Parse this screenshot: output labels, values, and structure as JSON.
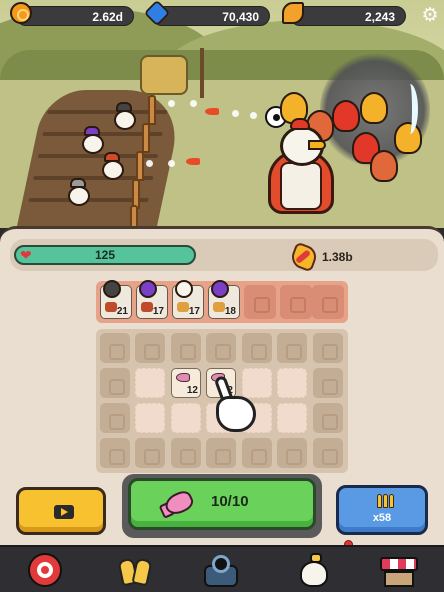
{
  "currency": {
    "coins": "2.62d",
    "gems": "70,430",
    "leaves": "2,243"
  },
  "player": {
    "hp": "125",
    "damage": "1.38b"
  },
  "squad": [
    {
      "level": "21"
    },
    {
      "level": "17"
    },
    {
      "level": "17"
    },
    {
      "level": "18"
    }
  ],
  "merge_grid": [
    {
      "level": "12"
    },
    {
      "level": "12"
    }
  ],
  "actions": {
    "summon": "10/10",
    "ammo": "x58"
  },
  "icons": {
    "top": [
      "coin-icon",
      "gem-icon",
      "leaf-icon",
      "settings-icon"
    ],
    "nav": [
      "target-icon",
      "gloves-icon",
      "cannon-icon",
      "chicken-icon",
      "shop-icon"
    ]
  },
  "colors": {
    "hp_bar": "#56c49a",
    "summon_button": "#6ad15a",
    "ad_button": "#f7c12f",
    "ammo_button": "#5a9ae5"
  }
}
